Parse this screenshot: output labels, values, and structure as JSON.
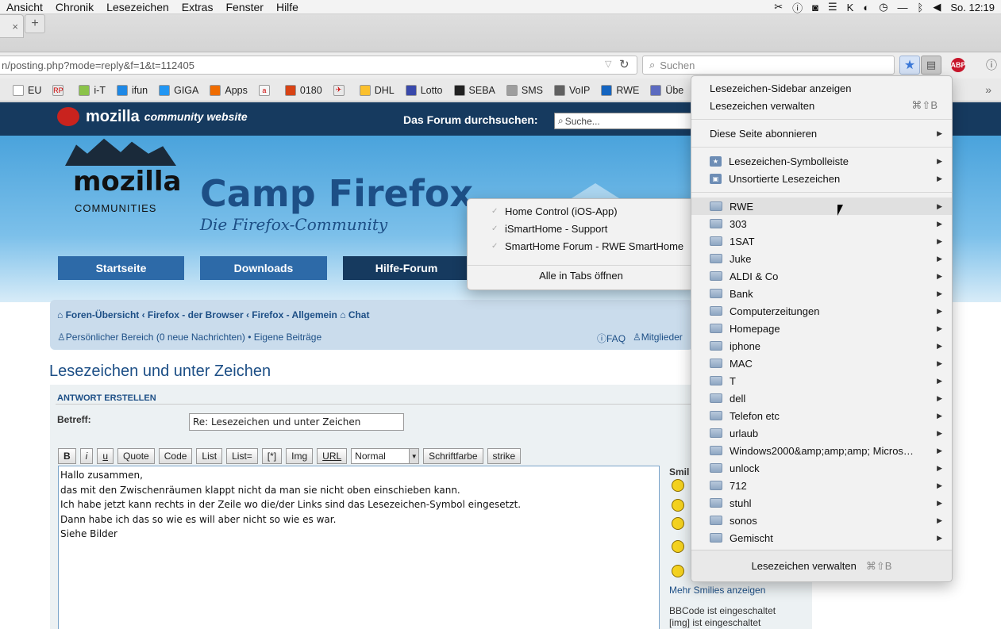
{
  "menubar": {
    "items": [
      "Ansicht",
      "Chronik",
      "Lesezeichen",
      "Extras",
      "Fenster",
      "Hilfe"
    ],
    "clock": "So. 12:19"
  },
  "tabs": {
    "close": "×",
    "new_tab": "+"
  },
  "nav": {
    "url": "n/posting.php?mode=reply&f=1&t=112405",
    "search_placeholder": "Suchen",
    "abp": "ABP"
  },
  "bookmarks_toolbar": [
    {
      "label": "EU",
      "color": "#ffffff"
    },
    {
      "label": "",
      "color": "#e8e8e8",
      "text": "RP"
    },
    {
      "label": "i-T",
      "color": "#8bc34a"
    },
    {
      "label": "ifun",
      "color": "#1e88e5"
    },
    {
      "label": "GIGA",
      "color": "#2196f3"
    },
    {
      "label": "Apps",
      "color": "#ef6c00"
    },
    {
      "label": "",
      "color": "#f6f6f6",
      "text": "a"
    },
    {
      "label": "0180",
      "color": "#d84315"
    },
    {
      "label": "",
      "color": "#e9e9e9",
      "text": "✈"
    },
    {
      "label": "DHL",
      "color": "#fbc02d"
    },
    {
      "label": "Lotto",
      "color": "#3949ab"
    },
    {
      "label": "SEBA",
      "color": "#222222"
    },
    {
      "label": "SMS",
      "color": "#9e9e9e"
    },
    {
      "label": "VoIP",
      "color": "#616161"
    },
    {
      "label": "RWE",
      "color": "#1565c0"
    },
    {
      "label": "Übe",
      "color": "#5c6bc0"
    }
  ],
  "site": {
    "brand": "mozilla",
    "brand_sub": "community website",
    "forum_search_label": "Das Forum durchsuchen:",
    "forum_search_placeholder": "Suche...",
    "logo_word": "mozilla",
    "logo_sub": "COMMUNITIES",
    "title": "Camp Firefox",
    "subtitle": "Die Firefox-Community",
    "nav": [
      "Startseite",
      "Downloads",
      "Hilfe-Forum"
    ],
    "breadcrumbs": "Foren-Übersicht ‹ Firefox - der Browser ‹ Firefox - Allgemein",
    "chat": "Chat",
    "ucp": "Persönlicher Bereich (0 neue Nachrichten) • Eigene Beiträge",
    "faq": "FAQ",
    "members": "Mitglieder",
    "topic_title": "Lesezeichen und unter Zeichen",
    "post_header": "ANTWORT ERSTELLEN",
    "subject_label": "Betreff:",
    "subject_value": "Re: Lesezeichen und unter Zeichen",
    "toolbar": [
      "B",
      "i",
      "u",
      "Quote",
      "Code",
      "List",
      "List=",
      "[*]",
      "Img",
      "URL"
    ],
    "fontsize": "Normal",
    "toolbar2": [
      "Schriftfarbe",
      "strike"
    ],
    "message": "Hallo zusammen,\ndas mit den Zwischenräumen klappt nicht da man sie nicht oben einschieben kann.\nIch habe jetzt kann rechts in der Zeile wo die/der Links sind das Lesezeichen-Symbol eingesetzt.\nDann habe ich das so wie es will aber nicht so wie es war.\nSiehe Bilder",
    "smilies_label": "Smil",
    "more_smilies": "Mehr Smilies anzeigen",
    "bbcode": "BBCode ist eingeschaltet",
    "img_status": "[img] ist eingeschaltet"
  },
  "submenu": {
    "items": [
      "Home Control (iOS-App)",
      "iSmartHome - Support",
      "SmartHome Forum - RWE SmartHome"
    ],
    "open_all": "Alle in Tabs öffnen"
  },
  "bookmarks_menu": {
    "show_sidebar": "Lesezeichen-Sidebar anzeigen",
    "manage": "Lesezeichen verwalten",
    "manage_shortcut": "⌘⇧B",
    "subscribe": "Diese Seite abonnieren",
    "toolbar_folder": "Lesezeichen-Symbolleiste",
    "unsorted": "Unsortierte Lesezeichen",
    "folders": [
      "RWE",
      "303",
      "1SAT",
      "Juke",
      "ALDI & Co",
      "Bank",
      "Computerzeitungen",
      "Homepage",
      "iphone",
      "MAC",
      "T",
      "dell",
      "Telefon etc",
      "urlaub",
      "Windows2000&amp;amp;amp; Micros…",
      "unlock",
      "712",
      "stuhl",
      "sonos",
      "Gemischt"
    ],
    "footer": "Lesezeichen verwalten",
    "footer_shortcut": "⌘⇧B"
  }
}
